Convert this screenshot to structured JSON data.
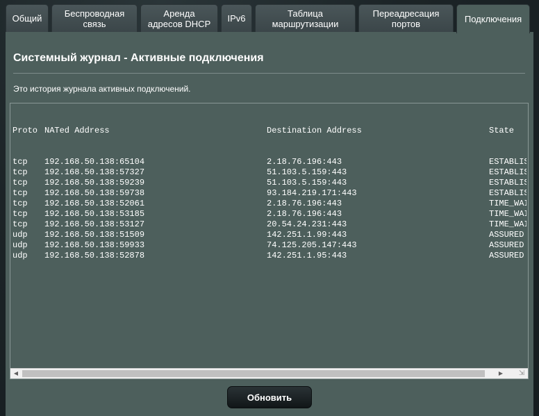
{
  "tabs": [
    {
      "label": "Общий"
    },
    {
      "label": "Беспроводная\nсвязь"
    },
    {
      "label": "Аренда\nадресов DHCP"
    },
    {
      "label": "IPv6"
    },
    {
      "label": "Таблица\nмаршрутизации"
    },
    {
      "label": "Переадресация\nпортов"
    },
    {
      "label": "Подключения",
      "active": true
    }
  ],
  "page": {
    "title": "Системный журнал - Активные подключения",
    "description": "Это история журнала активных подключений."
  },
  "log": {
    "headers": {
      "proto": "Proto",
      "nat": "NATed Address",
      "dest": "Destination Address",
      "state": "State"
    },
    "rows": [
      {
        "proto": "tcp",
        "nat": "192.168.50.138:65104",
        "dest": "2.18.76.196:443",
        "state": "ESTABLISHED"
      },
      {
        "proto": "tcp",
        "nat": "192.168.50.138:57327",
        "dest": "51.103.5.159:443",
        "state": "ESTABLISHED"
      },
      {
        "proto": "tcp",
        "nat": "192.168.50.138:59239",
        "dest": "51.103.5.159:443",
        "state": "ESTABLISHED"
      },
      {
        "proto": "tcp",
        "nat": "192.168.50.138:59738",
        "dest": "93.184.219.171:443",
        "state": "ESTABLISHED"
      },
      {
        "proto": "tcp",
        "nat": "192.168.50.138:52061",
        "dest": "2.18.76.196:443",
        "state": "TIME_WAIT"
      },
      {
        "proto": "tcp",
        "nat": "192.168.50.138:53185",
        "dest": "2.18.76.196:443",
        "state": "TIME_WAIT"
      },
      {
        "proto": "tcp",
        "nat": "192.168.50.138:53127",
        "dest": "20.54.24.231:443",
        "state": "TIME_WAIT"
      },
      {
        "proto": "udp",
        "nat": "192.168.50.138:51509",
        "dest": "142.251.1.99:443",
        "state": "ASSURED"
      },
      {
        "proto": "udp",
        "nat": "192.168.50.138:59933",
        "dest": "74.125.205.147:443",
        "state": "ASSURED"
      },
      {
        "proto": "udp",
        "nat": "192.168.50.138:52878",
        "dest": "142.251.1.95:443",
        "state": "ASSURED"
      }
    ]
  },
  "buttons": {
    "refresh_label": "Обновить"
  },
  "icons": {
    "scroll_left": "chevron-left-icon",
    "scroll_right": "chevron-right-icon",
    "resize_grip": "resize-grip-icon"
  }
}
